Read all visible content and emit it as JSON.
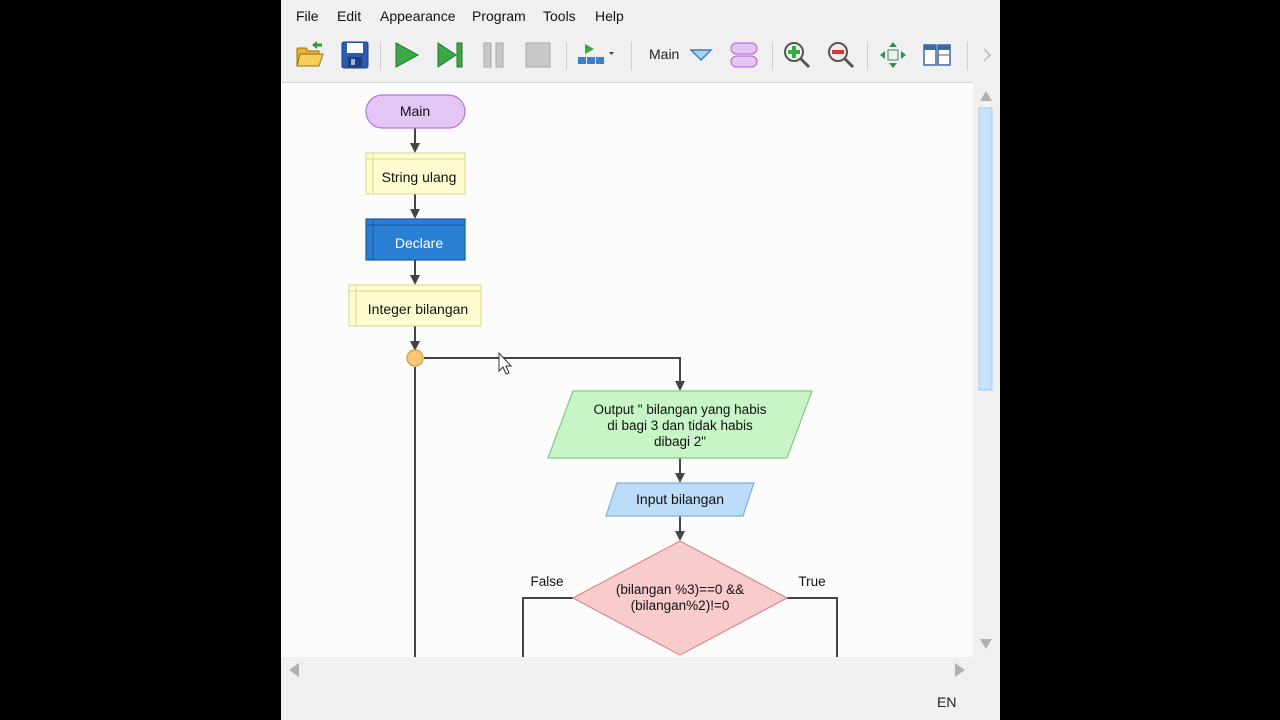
{
  "menu": {
    "file": "File",
    "edit": "Edit",
    "appearance": "Appearance",
    "program": "Program",
    "tools": "Tools",
    "help": "Help"
  },
  "toolbar": {
    "function_selector_value": "Main"
  },
  "flowchart": {
    "start_label": "Main",
    "comment_1": "String ulang",
    "declare_label": "Declare",
    "comment_2": "Integer bilangan",
    "output_line_1": "Output \" bilangan yang habis",
    "output_line_2": "di bagi 3 dan tidak habis",
    "output_line_3": "dibagi 2\"",
    "input_label": "Input bilangan",
    "decision_line_1": "(bilangan %3)==0 &&",
    "decision_line_2": "(bilangan%2)!=0",
    "false_label": "False",
    "true_label": "True"
  },
  "colors": {
    "start_fill": "#e4c6f5",
    "comment_fill": "#fdfdd0",
    "declare_fill": "#2a7fd4",
    "output_fill": "#c8f5c8",
    "input_fill": "#bcdcf7",
    "decision_fill": "#f8cccc",
    "loop_node_fill": "#f7c873"
  },
  "status": {
    "language": "EN"
  }
}
